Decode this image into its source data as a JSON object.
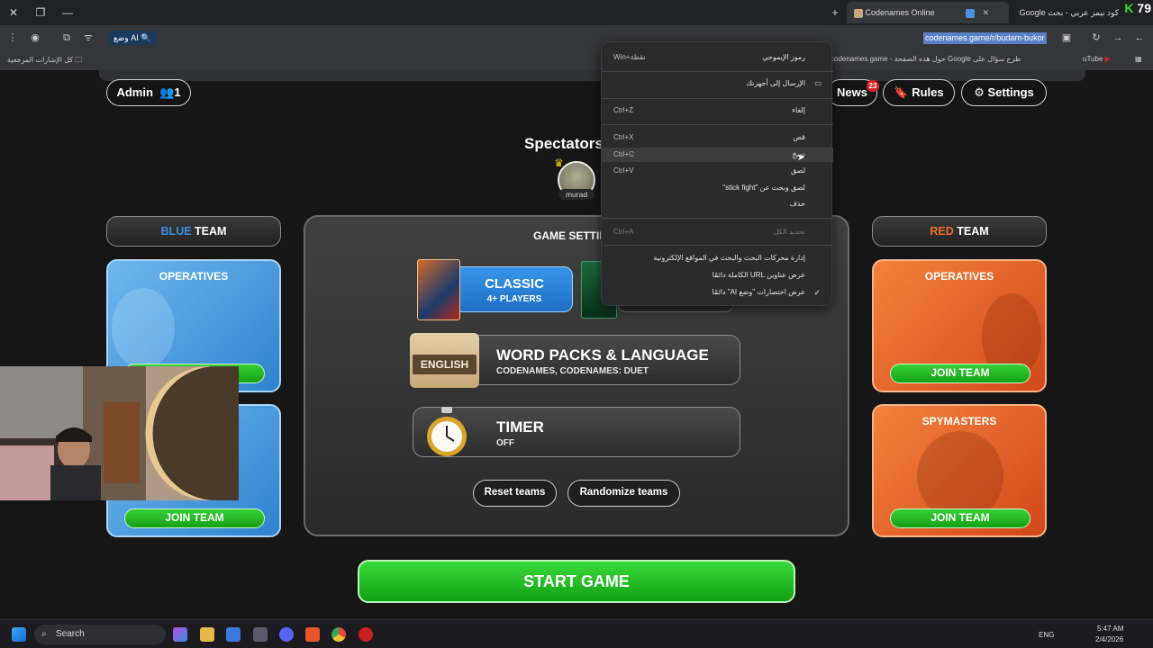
{
  "browser": {
    "tabs": [
      {
        "title": "كود نيمز عربي - بحث Google",
        "active": false
      },
      {
        "title": "Codenames Online",
        "active": true
      }
    ],
    "new_tab_symbol": "+",
    "tab_close_symbol": "✕",
    "score_badge": "79",
    "ai_mode_label": "وضع AI",
    "url": "codenames.game/r/budam-bukor",
    "bookmarks_all_label": "كل الإشارات المرجعية",
    "google_ask_text": "طرح سؤال على Google حول هذه الصفحة - codenames.game",
    "youtube_label": "uTube"
  },
  "context_menu": {
    "items": [
      {
        "label": "رموز الإيموجي",
        "shortcut": "Win+نقطة",
        "disabled": false
      },
      {
        "label": "الإرسال إلى أجهزتك",
        "shortcut": "",
        "disabled": false
      },
      {
        "label": "إلغاء",
        "shortcut": "Ctrl+Z",
        "disabled": false
      },
      {
        "label": "قص",
        "shortcut": "Ctrl+X",
        "disabled": false
      },
      {
        "label": "نسخ",
        "shortcut": "Ctrl+C",
        "disabled": false
      },
      {
        "label": "لصق",
        "shortcut": "Ctrl+V",
        "disabled": false
      },
      {
        "label": "لصق وبحث عن \"stick fight\"",
        "shortcut": "",
        "disabled": false
      },
      {
        "label": "حذف",
        "shortcut": "",
        "disabled": false
      },
      {
        "label": "تحديد الكل",
        "shortcut": "Ctrl+A",
        "disabled": true
      },
      {
        "label": "إدارة محركات البحث والبحث في المواقع الإلكترونية",
        "shortcut": "",
        "disabled": false
      },
      {
        "label": "عرض عناوين URL الكاملة دائمًا",
        "shortcut": "",
        "disabled": false
      },
      {
        "label": "عرض اختصارات \"وضع AI\" دائمًا",
        "shortcut": "",
        "disabled": false
      }
    ],
    "check_symbol": "✓"
  },
  "header": {
    "admin_label": "Admin",
    "player_count": "1",
    "news_label": "News",
    "news_badge": "23",
    "rules_label": "Rules",
    "settings_label": "Settings"
  },
  "spectators": {
    "title": "Spectators",
    "player_name": "murad"
  },
  "blue_team": {
    "header_color_word": "BLUE",
    "header_rest": "TEAM",
    "operatives_title": "OPERATIVES",
    "join_label": "JOIN TEAM",
    "accent": "#2f82cf"
  },
  "red_team": {
    "header_color_word": "RED",
    "header_rest": "TEAM",
    "operatives_title": "OPERATIVES",
    "spymasters_title": "SPYMASTERS",
    "join_label": "JOIN TEAM",
    "accent": "#d2481a"
  },
  "game_settings": {
    "title": "GAME SETTINGS",
    "mode_name": "CLASSIC",
    "mode_players": "4+ PLAYERS",
    "word_packs_title": "WORD PACKS & LANGUAGE",
    "word_packs_sub": "CODENAMES, CODENAMES: DUET",
    "language_badge": "ENGLISH",
    "timer_title": "TIMER",
    "timer_value": "OFF",
    "reset_label": "Reset teams",
    "randomize_label": "Randomize teams"
  },
  "start_label": "START GAME",
  "taskbar": {
    "search_label": "Search",
    "language": "ENG",
    "time": "5:47 AM",
    "date": "2/4/2026"
  }
}
